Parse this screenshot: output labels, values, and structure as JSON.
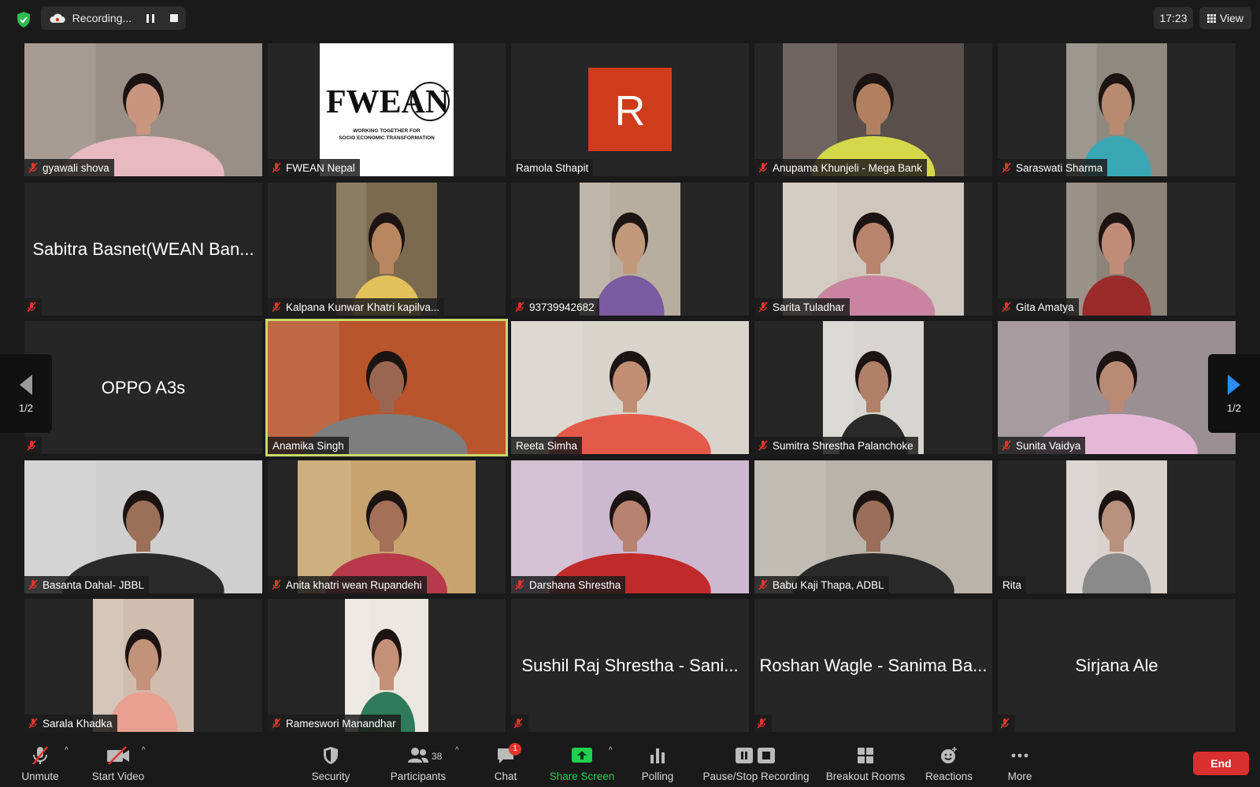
{
  "topbar": {
    "recording_label": "Recording...",
    "clock": "17:23",
    "view_label": "View"
  },
  "pager": {
    "left": "1/2",
    "right": "1/2"
  },
  "participants": [
    {
      "name": "gyawali shova",
      "muted": true,
      "video": true
    },
    {
      "name": "FWEAN Nepal",
      "muted": true,
      "video": true,
      "logo_text": "FWEAN",
      "logo_sub1": "WORKING TOGETHER FOR",
      "logo_sub2": "SOCIO ECONOMIC TRANSFORMATION"
    },
    {
      "name": "Ramola Sthapit",
      "muted": false,
      "video": true,
      "avatar_letter": "R"
    },
    {
      "name": "Anupama Khunjeli - Mega Bank",
      "muted": true,
      "video": true
    },
    {
      "name": "Saraswati Sharma",
      "muted": true,
      "video": true
    },
    {
      "name": "Sabitra Basnet(WEAN Ban...",
      "muted": true,
      "video": false
    },
    {
      "name": "Kalpana Kunwar Khatri kapilva...",
      "muted": true,
      "video": true
    },
    {
      "name": "93739942682",
      "muted": true,
      "video": true
    },
    {
      "name": "Sarita Tuladhar",
      "muted": true,
      "video": true
    },
    {
      "name": "Gita Amatya",
      "muted": true,
      "video": true
    },
    {
      "name": "OPPO A3s",
      "muted": true,
      "video": false
    },
    {
      "name": "Anamika Singh",
      "muted": false,
      "video": true,
      "active": true
    },
    {
      "name": "Reeta Simha",
      "muted": false,
      "video": true
    },
    {
      "name": "Sumitra Shrestha Palanchoke",
      "muted": true,
      "video": true
    },
    {
      "name": "Sunita Vaidya",
      "muted": true,
      "video": true
    },
    {
      "name": "Basanta Dahal- JBBL",
      "muted": true,
      "video": true
    },
    {
      "name": "Anita khatri wean Rupandehi",
      "muted": true,
      "video": true
    },
    {
      "name": "Darshana Shrestha",
      "muted": true,
      "video": true
    },
    {
      "name": "Babu Kaji Thapa, ADBL",
      "muted": true,
      "video": true
    },
    {
      "name": "Rita",
      "muted": false,
      "video": true
    },
    {
      "name": "Sarala Khadka",
      "muted": true,
      "video": true
    },
    {
      "name": "Rameswori Manandhar",
      "muted": true,
      "video": true
    },
    {
      "name": "Sushil Raj Shrestha - Sani...",
      "muted": true,
      "video": false
    },
    {
      "name": "Roshan Wagle - Sanima Ba...",
      "muted": true,
      "video": false
    },
    {
      "name": "Sirjana Ale",
      "muted": true,
      "video": false
    }
  ],
  "toolbar": {
    "unmute": "Unmute",
    "start_video": "Start Video",
    "security": "Security",
    "participants": "Participants",
    "participants_count": "38",
    "chat": "Chat",
    "chat_badge": "1",
    "share_screen": "Share Screen",
    "polling": "Polling",
    "pause_stop_recording": "Pause/Stop Recording",
    "breakout_rooms": "Breakout Rooms",
    "reactions": "Reactions",
    "more": "More",
    "end": "End"
  },
  "colors": {
    "accent_green": "#1fd14f",
    "active_speaker": "#c7d96a",
    "end_red": "#d9302f",
    "muted_red": "#e0362c",
    "avatar_orange": "#cf3c1b"
  }
}
